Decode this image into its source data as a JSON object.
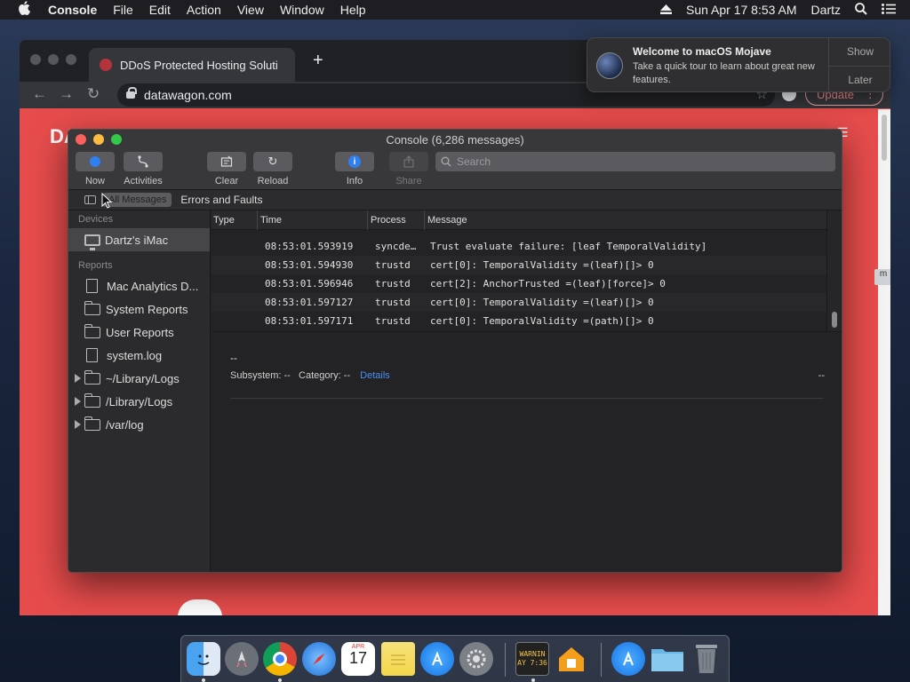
{
  "menubar": {
    "app_name": "Console",
    "menus": [
      "File",
      "Edit",
      "Action",
      "View",
      "Window",
      "Help"
    ],
    "datetime": "Sun Apr 17  8:53 AM",
    "user": "Dartz"
  },
  "browser": {
    "tab_title": "DDoS Protected Hosting Soluti",
    "url": "datawagon.com",
    "update_label": "Update",
    "page_logo": "DA"
  },
  "console": {
    "title": "Console (6,286 messages)",
    "toolbar": {
      "now": "Now",
      "activities": "Activities",
      "clear": "Clear",
      "reload": "Reload",
      "info": "Info",
      "share": "Share",
      "search_placeholder": "Search"
    },
    "filters": {
      "all_messages": "All Messages",
      "errors_faults": "Errors and Faults"
    },
    "sidebar": {
      "devices_header": "Devices",
      "device": "Dartz's iMac",
      "reports_header": "Reports",
      "items": [
        {
          "label": "Mac Analytics D...",
          "icon": "doc"
        },
        {
          "label": "System Reports",
          "icon": "folder"
        },
        {
          "label": "User Reports",
          "icon": "folder"
        },
        {
          "label": "system.log",
          "icon": "doc"
        },
        {
          "label": "~/Library/Logs",
          "icon": "folder"
        },
        {
          "label": "/Library/Logs",
          "icon": "folder"
        },
        {
          "label": "/var/log",
          "icon": "folder"
        }
      ]
    },
    "columns": {
      "type": "Type",
      "time": "Time",
      "process": "Process",
      "message": "Message"
    },
    "rows": [
      {
        "time": "08:53:01.593919",
        "process": "syncde…",
        "message": "Trust evaluate failure: [leaf TemporalValidity]"
      },
      {
        "time": "08:53:01.594930",
        "process": "trustd",
        "message": "cert[0]: TemporalValidity =(leaf)[]> 0"
      },
      {
        "time": "08:53:01.596946",
        "process": "trustd",
        "message": "cert[2]: AnchorTrusted =(leaf)[force]> 0"
      },
      {
        "time": "08:53:01.597127",
        "process": "trustd",
        "message": "cert[0]: TemporalValidity =(leaf)[]> 0"
      },
      {
        "time": "08:53:01.597171",
        "process": "trustd",
        "message": "cert[0]: TemporalValidity =(path)[]> 0"
      }
    ],
    "detail": {
      "dash": "--",
      "subsystem": "Subsystem: --",
      "category": "Category: --",
      "details_link": "Details",
      "right": "--"
    }
  },
  "notification": {
    "title": "Welcome to macOS Mojave",
    "body": "Take a quick tour to learn about great new features.",
    "show_label": "Show",
    "later_label": "Later"
  },
  "dock": {
    "calendar_month": "APR",
    "calendar_day": "17",
    "console_text_1": "WARNIN",
    "console_text_2": "AY 7:36"
  }
}
